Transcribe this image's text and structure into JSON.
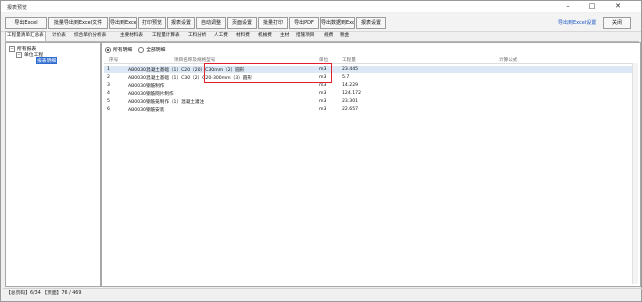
{
  "window": {
    "title": "报表预览",
    "minimize": "–",
    "maximize": "□",
    "close": "✕"
  },
  "toolbar": {
    "buttons": [
      "导出Excel",
      "批量导出到Excel文件",
      "导出到Excel",
      "打印预览",
      "报表设置",
      "自动调整",
      "页面设置",
      "批量打印",
      "导出PDF",
      "导出数据到Excel",
      "报表设置"
    ],
    "link": "导出到Excel设置",
    "close_label": "关闭"
  },
  "tabs": [
    "工程量清单汇总表",
    "计价表",
    "综合单价分析表",
    "主要材料表",
    "工程量计算表",
    "工料分析",
    "人工费",
    "材料费",
    "机械费",
    "主材",
    "措施项目",
    "规费",
    "税金"
  ],
  "tree": {
    "root": "所有报表",
    "child": "单位工程",
    "selected": "报表明细"
  },
  "filter": {
    "option_a": "所有明细",
    "option_b": "全部明细"
  },
  "table": {
    "headers": [
      "序号",
      "项目名称及规格型号",
      "单位",
      "工程量",
      "计算公式"
    ],
    "rows": [
      {
        "num": "1",
        "name": "AB0030混凝土基础（1）C20（20）C30mm（2）圆形",
        "unit": "m3",
        "qty": "23.445",
        "formula": ""
      },
      {
        "num": "2",
        "name": "AB0030混凝土基础（1）C30（2）C20-300mm（3）圆形",
        "unit": "m3",
        "qty": "5.7",
        "formula": ""
      },
      {
        "num": "3",
        "name": "AB0030钢筋制作",
        "unit": "m3",
        "qty": "14.229",
        "formula": ""
      },
      {
        "num": "4",
        "name": "AB0030钢筋网片制作",
        "unit": "m3",
        "qty": "124.172",
        "formula": ""
      },
      {
        "num": "5",
        "name": "AB0030钢筋笼制作（1）混凝土灌注",
        "unit": "m3",
        "qty": "23.301",
        "formula": ""
      },
      {
        "num": "6",
        "name": "AB0030钢筋安装",
        "unit": "m3",
        "qty": "22.657",
        "formula": ""
      }
    ]
  },
  "status": "【总页码】6/34 【页面】76 / 469"
}
